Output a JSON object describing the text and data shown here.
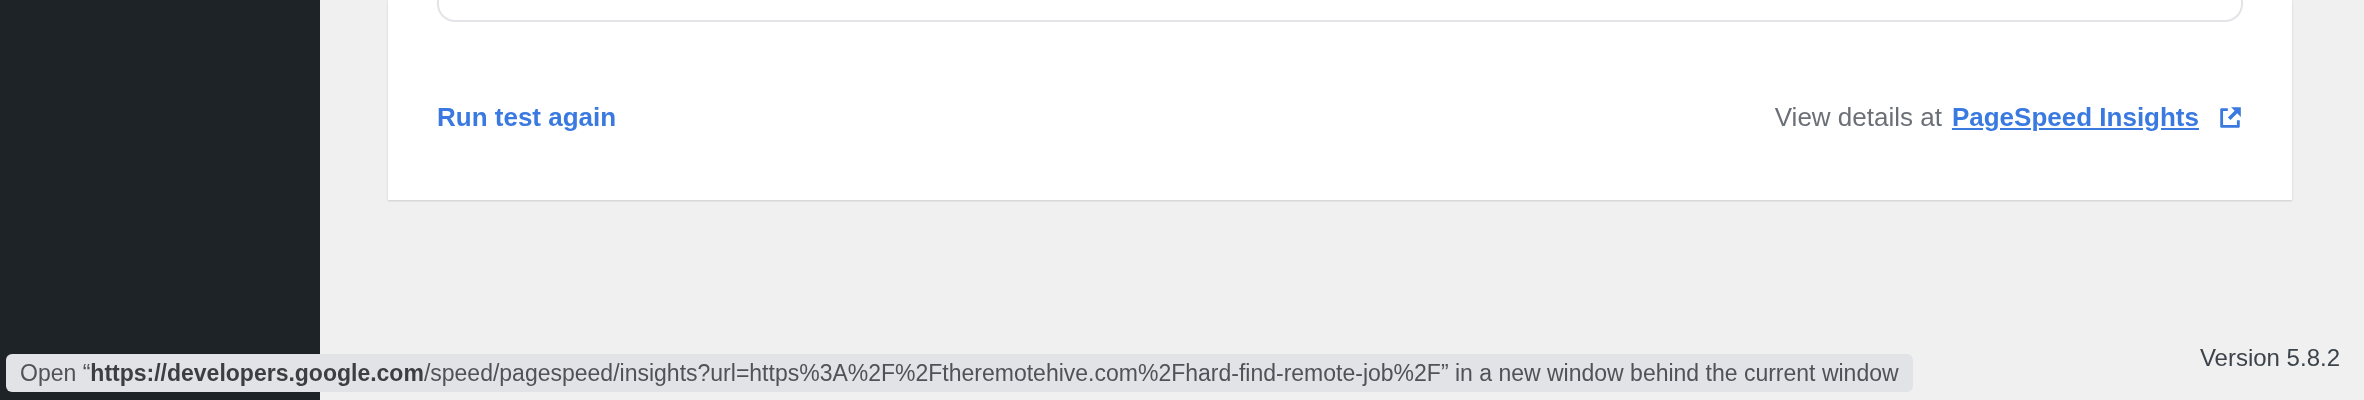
{
  "card": {
    "run_again_link": "Run test again",
    "details_label": "View details at",
    "details_link": "PageSpeed Insights"
  },
  "footer": {
    "version": "Version 5.8.2"
  },
  "status_tooltip": {
    "text": "Open “**https://developers.google.com**/speed/pagespeed/insights?url=https%3A%2F%2Ftheremotehive.com%2Fhard-find-remote-job%2F” in a new window behind the current window"
  }
}
